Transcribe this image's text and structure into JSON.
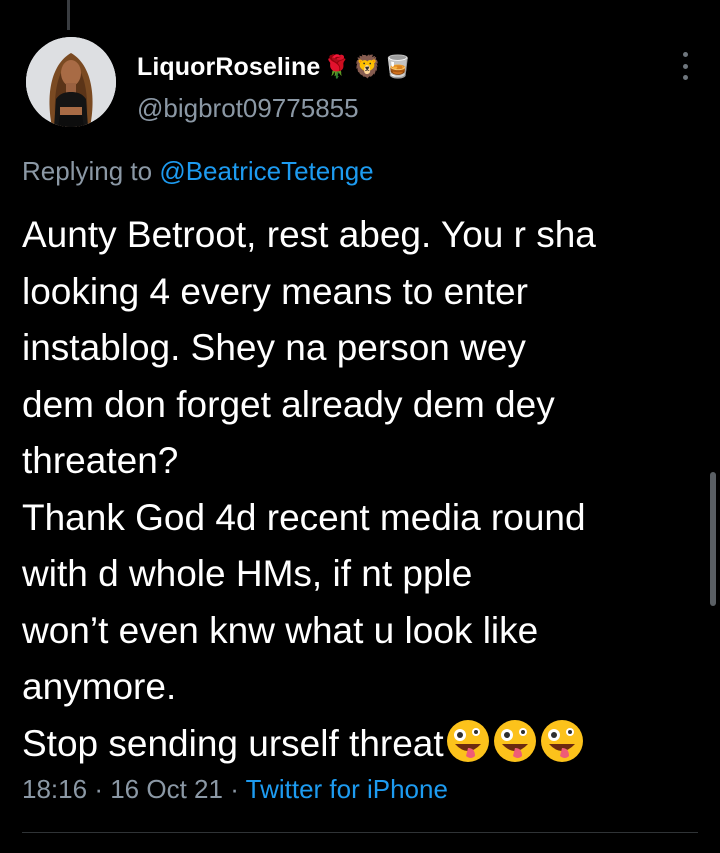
{
  "author": {
    "display_name": "LiquorRoseline",
    "name_emojis": [
      "🌹",
      "🦁",
      "🥃"
    ],
    "handle": "@bigbrot09775855"
  },
  "reply": {
    "prefix": "Replying to",
    "mention": "@BeatriceTetenge"
  },
  "tweet": {
    "lines": [
      "Aunty Betroot, rest abeg. You r sha",
      "looking 4 every means to enter",
      "instablog. Shey na person wey",
      "dem don forget already dem dey",
      "threaten?",
      "Thank God 4d recent media round",
      "with d whole HMs, if nt pple",
      "won’t even knw what u look like",
      "anymore.",
      "Stop sending urself threat"
    ],
    "trailing_emoji": "zany-face-emoji",
    "trailing_emoji_count": 3
  },
  "meta": {
    "time": "18:16",
    "separator": "·",
    "date": "16 Oct 21",
    "source": "Twitter for iPhone"
  },
  "colors": {
    "background": "#000000",
    "text": "#ffffff",
    "secondary": "#8b98a5",
    "link": "#1d9bf0",
    "divider": "#2f3336"
  },
  "icons": {
    "more": "vertical-ellipsis-icon",
    "avatar": "user-avatar"
  }
}
